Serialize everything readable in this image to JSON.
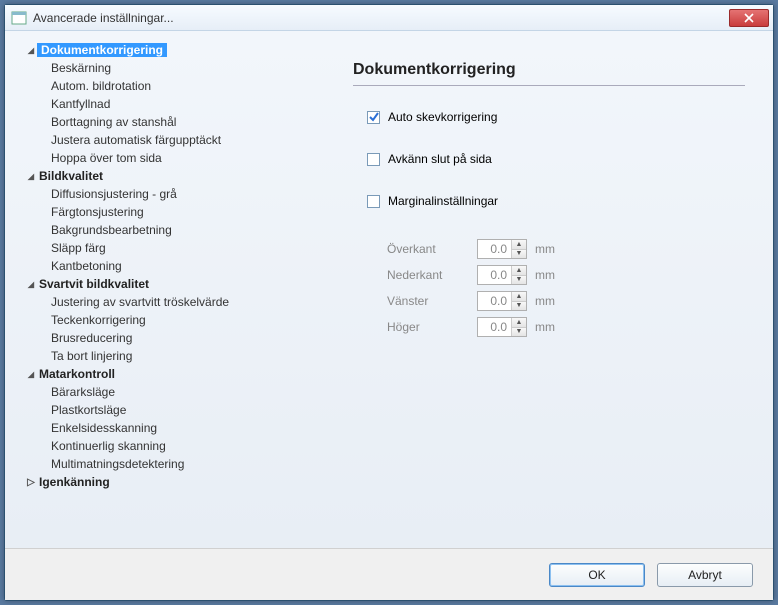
{
  "window": {
    "title": "Avancerade inställningar..."
  },
  "sidebar": {
    "sections": [
      {
        "label": "Dokumentkorrigering",
        "expanded": true,
        "selected": true,
        "items": [
          "Beskärning",
          "Autom. bildrotation",
          "Kantfyllnad",
          "Borttagning av stanshål",
          "Justera automatisk färgupptäckt",
          "Hoppa över tom sida"
        ]
      },
      {
        "label": "Bildkvalitet",
        "expanded": true,
        "selected": false,
        "items": [
          "Diffusionsjustering - grå",
          "Färgtonsjustering",
          "Bakgrundsbearbetning",
          "Släpp färg",
          "Kantbetoning"
        ]
      },
      {
        "label": "Svartvit bildkvalitet",
        "expanded": true,
        "selected": false,
        "items": [
          "Justering av svartvitt tröskelvärde",
          "Teckenkorrigering",
          "Brusreducering",
          "Ta bort linjering"
        ]
      },
      {
        "label": "Matarkontroll",
        "expanded": true,
        "selected": false,
        "items": [
          "Bärarksläge",
          "Plastkortsläge",
          "Enkelsidesskanning",
          "Kontinuerlig skanning",
          "Multimatningsdetektering"
        ]
      },
      {
        "label": "Igenkänning",
        "expanded": false,
        "selected": false,
        "items": []
      }
    ]
  },
  "panel": {
    "title": "Dokumentkorrigering",
    "auto_deskew": {
      "label": "Auto skevkorrigering",
      "checked": true
    },
    "detect_end": {
      "label": "Avkänn slut på sida",
      "checked": false
    },
    "margin_settings": {
      "label": "Marginalinställningar",
      "checked": false
    },
    "margins": {
      "unit": "mm",
      "rows": [
        {
          "label": "Överkant",
          "value": "0.0"
        },
        {
          "label": "Nederkant",
          "value": "0.0"
        },
        {
          "label": "Vänster",
          "value": "0.0"
        },
        {
          "label": "Höger",
          "value": "0.0"
        }
      ]
    }
  },
  "buttons": {
    "ok": "OK",
    "cancel": "Avbryt"
  }
}
